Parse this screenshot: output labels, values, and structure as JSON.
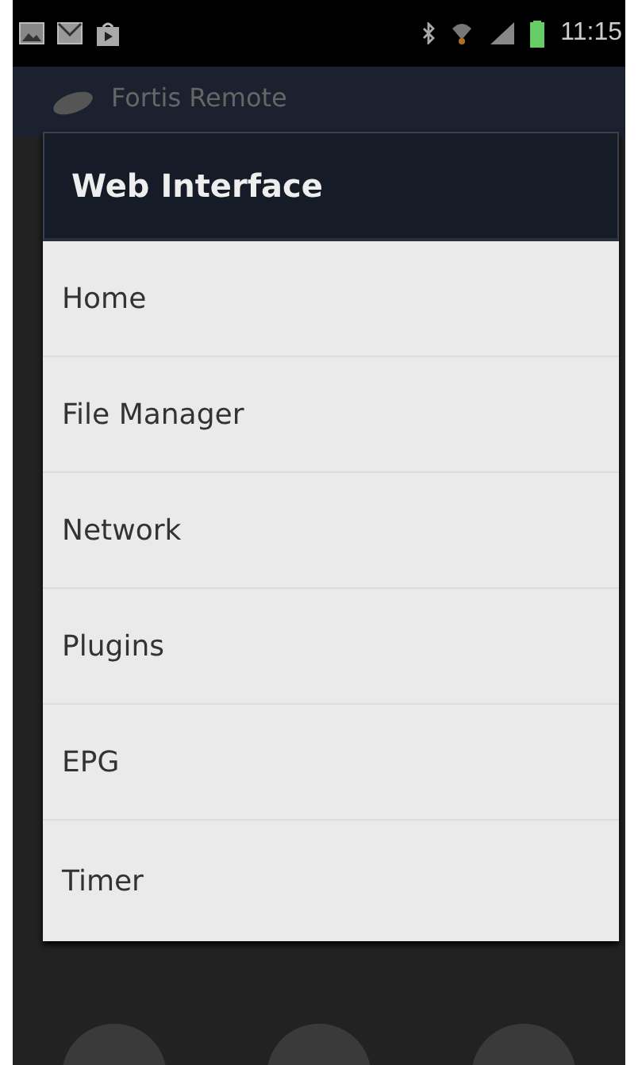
{
  "status_bar": {
    "time": "11:15"
  },
  "app_bar": {
    "title": "Fortis Remote"
  },
  "dialog": {
    "title": "Web Interface",
    "items": [
      "Home",
      "File Manager",
      "Network",
      "Plugins",
      "EPG",
      "Timer"
    ]
  }
}
